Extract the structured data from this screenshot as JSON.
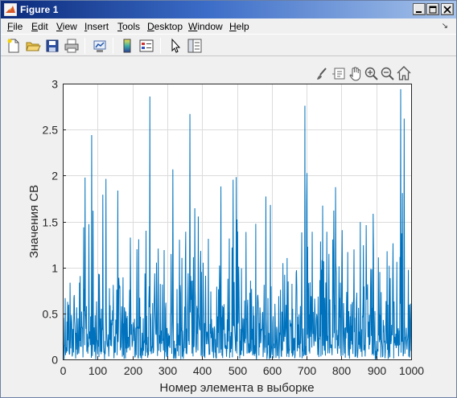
{
  "window": {
    "title": "Figure 1",
    "icon": "matlab-logo-icon"
  },
  "menu": [
    {
      "label": "File",
      "u": "F",
      "rest": "ile"
    },
    {
      "label": "Edit",
      "u": "E",
      "rest": "dit"
    },
    {
      "label": "View",
      "u": "V",
      "rest": "iew"
    },
    {
      "label": "Insert",
      "u": "I",
      "rest": "nsert"
    },
    {
      "label": "Tools",
      "u": "T",
      "rest": "ools"
    },
    {
      "label": "Desktop",
      "u": "D",
      "rest": "esktop"
    },
    {
      "label": "Window",
      "u": "W",
      "rest": "indow"
    },
    {
      "label": "Help",
      "u": "H",
      "rest": "elp"
    }
  ],
  "toolbar_icons": [
    "new-figure-icon",
    "open-file-icon",
    "save-icon",
    "print-icon",
    "link-plot-icon",
    "colorbar-icon",
    "legend-icon",
    "edit-plot-icon",
    "property-inspector-icon"
  ],
  "axes_toolbar_icons": [
    "brush-icon",
    "datatip-icon",
    "pan-icon",
    "zoom-in-icon",
    "zoom-out-icon",
    "home-icon"
  ],
  "colors": {
    "series": "#0072bd",
    "grid": "#dcdcdc",
    "axes_bg": "#ffffff",
    "figure_bg": "#f0f0f0"
  },
  "chart_data": {
    "type": "line",
    "title": "",
    "xlabel": "Номер элемента в выборке",
    "ylabel": "Значения СВ",
    "xlim": [
      0,
      1000
    ],
    "ylim": [
      0,
      3
    ],
    "xticks": [
      0,
      100,
      200,
      300,
      400,
      500,
      600,
      700,
      800,
      900,
      1000
    ],
    "yticks": [
      0,
      0.5,
      1,
      1.5,
      2,
      2.5,
      3
    ],
    "xtick_labels": [
      "0",
      "100",
      "200",
      "300",
      "400",
      "500",
      "600",
      "700",
      "800",
      "900",
      "1000"
    ],
    "ytick_labels": [
      "0",
      "0.5",
      "1",
      "1.5",
      "2",
      "2.5",
      "3"
    ],
    "grid": true,
    "box": true,
    "series": [
      {
        "generator": "exponential-like random sample, 1000 points",
        "n": 1000,
        "notable_peaks": [
          {
            "x": 83,
            "y": 2.44
          },
          {
            "x": 250,
            "y": 2.86
          },
          {
            "x": 365,
            "y": 2.67
          },
          {
            "x": 695,
            "y": 2.76
          },
          {
            "x": 970,
            "y": 2.94
          },
          {
            "x": 980,
            "y": 2.62
          }
        ]
      }
    ]
  }
}
